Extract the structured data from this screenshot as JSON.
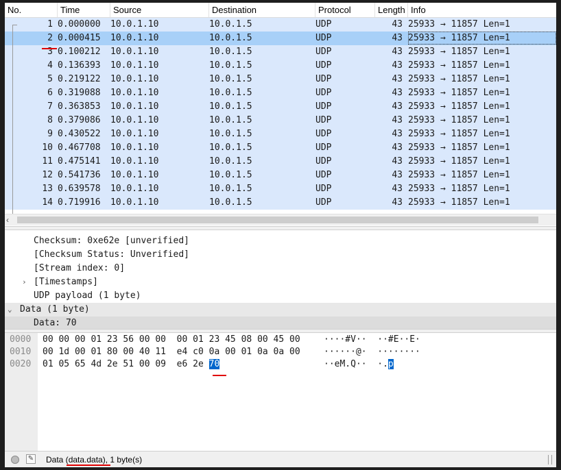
{
  "columns": [
    "No.",
    "Time",
    "Source",
    "Destination",
    "Protocol",
    "Length",
    "Info"
  ],
  "packets": [
    {
      "no": "1",
      "time": "0.000000",
      "src": "10.0.1.10",
      "dst": "10.0.1.5",
      "proto": "UDP",
      "len": "43",
      "info": "25933 → 11857 Len=1"
    },
    {
      "no": "2",
      "time": "0.000415",
      "src": "10.0.1.10",
      "dst": "10.0.1.5",
      "proto": "UDP",
      "len": "43",
      "info": "25933 → 11857 Len=1"
    },
    {
      "no": "3",
      "time": "0.100212",
      "src": "10.0.1.10",
      "dst": "10.0.1.5",
      "proto": "UDP",
      "len": "43",
      "info": "25933 → 11857 Len=1"
    },
    {
      "no": "4",
      "time": "0.136393",
      "src": "10.0.1.10",
      "dst": "10.0.1.5",
      "proto": "UDP",
      "len": "43",
      "info": "25933 → 11857 Len=1"
    },
    {
      "no": "5",
      "time": "0.219122",
      "src": "10.0.1.10",
      "dst": "10.0.1.5",
      "proto": "UDP",
      "len": "43",
      "info": "25933 → 11857 Len=1"
    },
    {
      "no": "6",
      "time": "0.319088",
      "src": "10.0.1.10",
      "dst": "10.0.1.5",
      "proto": "UDP",
      "len": "43",
      "info": "25933 → 11857 Len=1"
    },
    {
      "no": "7",
      "time": "0.363853",
      "src": "10.0.1.10",
      "dst": "10.0.1.5",
      "proto": "UDP",
      "len": "43",
      "info": "25933 → 11857 Len=1"
    },
    {
      "no": "8",
      "time": "0.379086",
      "src": "10.0.1.10",
      "dst": "10.0.1.5",
      "proto": "UDP",
      "len": "43",
      "info": "25933 → 11857 Len=1"
    },
    {
      "no": "9",
      "time": "0.430522",
      "src": "10.0.1.10",
      "dst": "10.0.1.5",
      "proto": "UDP",
      "len": "43",
      "info": "25933 → 11857 Len=1"
    },
    {
      "no": "10",
      "time": "0.467708",
      "src": "10.0.1.10",
      "dst": "10.0.1.5",
      "proto": "UDP",
      "len": "43",
      "info": "25933 → 11857 Len=1"
    },
    {
      "no": "11",
      "time": "0.475141",
      "src": "10.0.1.10",
      "dst": "10.0.1.5",
      "proto": "UDP",
      "len": "43",
      "info": "25933 → 11857 Len=1"
    },
    {
      "no": "12",
      "time": "0.541736",
      "src": "10.0.1.10",
      "dst": "10.0.1.5",
      "proto": "UDP",
      "len": "43",
      "info": "25933 → 11857 Len=1"
    },
    {
      "no": "13",
      "time": "0.639578",
      "src": "10.0.1.10",
      "dst": "10.0.1.5",
      "proto": "UDP",
      "len": "43",
      "info": "25933 → 11857 Len=1"
    },
    {
      "no": "14",
      "time": "0.719916",
      "src": "10.0.1.10",
      "dst": "10.0.1.5",
      "proto": "UDP",
      "len": "43",
      "info": "25933 → 11857 Len=1"
    }
  ],
  "selected_packet": "2",
  "details": [
    {
      "text": "Checksum: 0xe62e [unverified]",
      "arrow": ""
    },
    {
      "text": "[Checksum Status: Unverified]",
      "arrow": ""
    },
    {
      "text": "[Stream index: 0]",
      "arrow": ""
    },
    {
      "text": "[Timestamps]",
      "arrow": "›"
    },
    {
      "text": "UDP payload (1 byte)",
      "arrow": ""
    },
    {
      "text": "Data (1 byte)",
      "arrow": "⌄"
    },
    {
      "text": "Data: 70",
      "arrow": ""
    }
  ],
  "bytes": [
    {
      "offset": "0000",
      "hex": "00 00 00 01 23 56 00 00  00 01 23 45 08 00 45 00",
      "ascii": "····#V··  ··#E··E·"
    },
    {
      "offset": "0010",
      "hex": "00 1d 00 01 80 00 40 11  e4 c0 0a 00 01 0a 0a 00",
      "ascii": "······@·  ········"
    },
    {
      "offset": "0020",
      "hex_before": "01 05 65 4d 2e 51 00 09  e6 2e ",
      "hex_selected": "70",
      "ascii_before": "··eM.Q··  ·.",
      "ascii_selected": "p"
    }
  ],
  "status": {
    "text_prefix": "Data (",
    "text_field": "data.data",
    "text_suffix": "), 1 byte(s)"
  },
  "colors": {
    "row_bg": "#dae8fc",
    "row_selected_bg": "#a8d0f8",
    "byte_highlight": "#0066cc",
    "annotation_red": "#e00000"
  }
}
